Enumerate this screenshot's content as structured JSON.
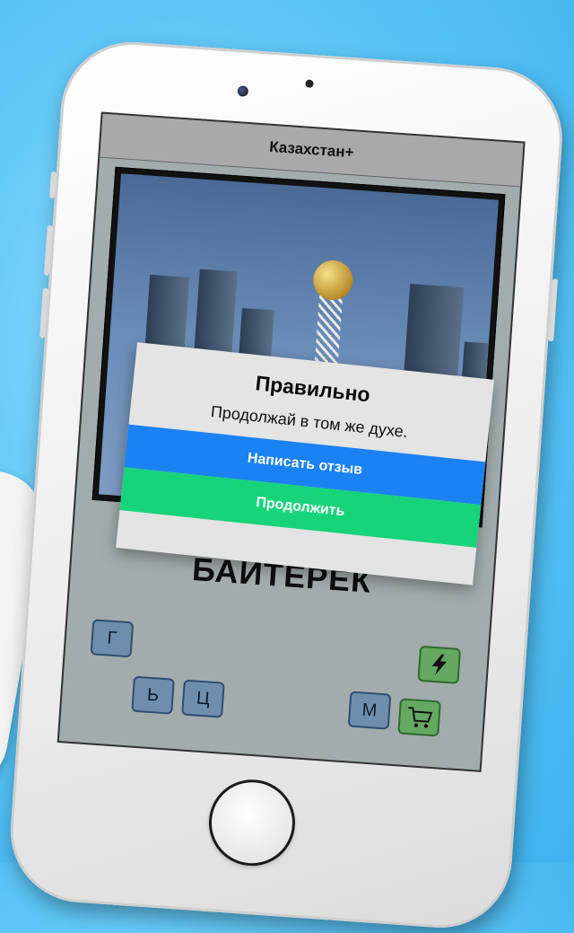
{
  "app": {
    "title": "Казахстан+"
  },
  "puzzle": {
    "photo_icon": "photo-bayterek-tower",
    "answer": "БАЙТЕРЕК"
  },
  "letters": [
    {
      "label": "Г"
    },
    {
      "label": "Ь"
    },
    {
      "label": "Ц"
    },
    {
      "label": "М"
    }
  ],
  "actions": {
    "hint_icon": "lightning-icon",
    "shop_icon": "cart-icon"
  },
  "dialog": {
    "title": "Правильно",
    "message": "Продолжай в том же духе.",
    "review_button": "Написать отзыв",
    "continue_button": "Продолжить"
  },
  "colors": {
    "background": "#5ec6f6",
    "review_button": "#1a82f2",
    "continue_button": "#17d47a",
    "letter_tile": "#6f8dac",
    "action_tile": "#64a862"
  }
}
